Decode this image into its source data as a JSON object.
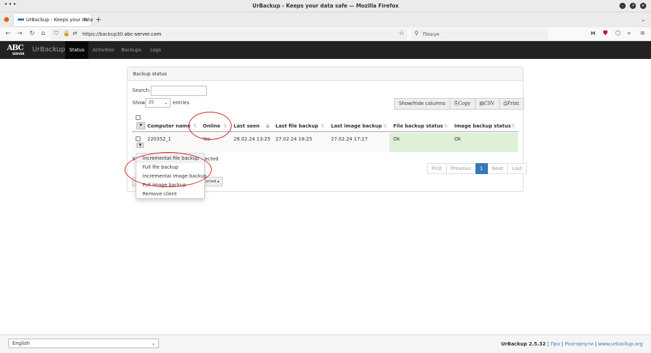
{
  "window": {
    "title": "UrBackup - Keeps your data safe — Mozilla Firefox",
    "menu_dots": "•••"
  },
  "browser": {
    "tab_label": "UrBackup - Keeps your data",
    "url_plain": "https://backup30.",
    "url_host": "abc-server.com",
    "search_placeholder": "Пошук"
  },
  "app": {
    "logo_text": "ABC",
    "logo_subtext": "SERVER",
    "brand": "UrBackup",
    "nav": [
      {
        "label": "Status",
        "active": true
      },
      {
        "label": "Activities",
        "active": false
      },
      {
        "label": "Backups",
        "active": false
      },
      {
        "label": "Logs",
        "active": false
      }
    ]
  },
  "panel": {
    "title": "Backup status",
    "search_label": "Search:",
    "search_value": "",
    "show_label": "Show",
    "show_value": "25",
    "entries_label": "entries",
    "buttons": {
      "show_hide": "Show/hide columns",
      "copy": "Copy",
      "csv": "CSV",
      "print": "Print"
    }
  },
  "table": {
    "headers": {
      "computer_name": "Computer name",
      "online": "Online",
      "last_seen": "Last seen",
      "last_file_backup": "Last file backup",
      "last_image_backup": "Last image backup",
      "file_backup_status": "File backup status",
      "image_backup_status": "Image backup status"
    },
    "rows": [
      {
        "computer_name": "220352_1",
        "online": "Yes",
        "last_seen": "28.02.24 13:25",
        "last_file_backup": "27.02.24 18:25",
        "last_image_backup": "27.02.24 17:27",
        "file_backup_status": "Ok",
        "image_backup_status": "Ok"
      }
    ],
    "info_partial_left": "S",
    "info_partial_right": "ected",
    "selected_btn_partial": "ected"
  },
  "dropdown": {
    "items": [
      "Incremental file backup",
      "Full file backup",
      "Incremental image backup",
      "Full image backup",
      "Remove client"
    ]
  },
  "pagination": {
    "first": "First",
    "previous": "Previous",
    "current": "1",
    "next": "Next",
    "last": "Last"
  },
  "footer": {
    "language": "English",
    "version": "UrBackup 2.5.32",
    "sep": "|",
    "about": "Про",
    "develop": "Розгорнути",
    "site": "www.urbackup.org"
  },
  "colors": {
    "annotation": "#d9201f",
    "success_bg": "#dff0d8",
    "page_active": "#337ab7",
    "navbar": "#222222"
  }
}
